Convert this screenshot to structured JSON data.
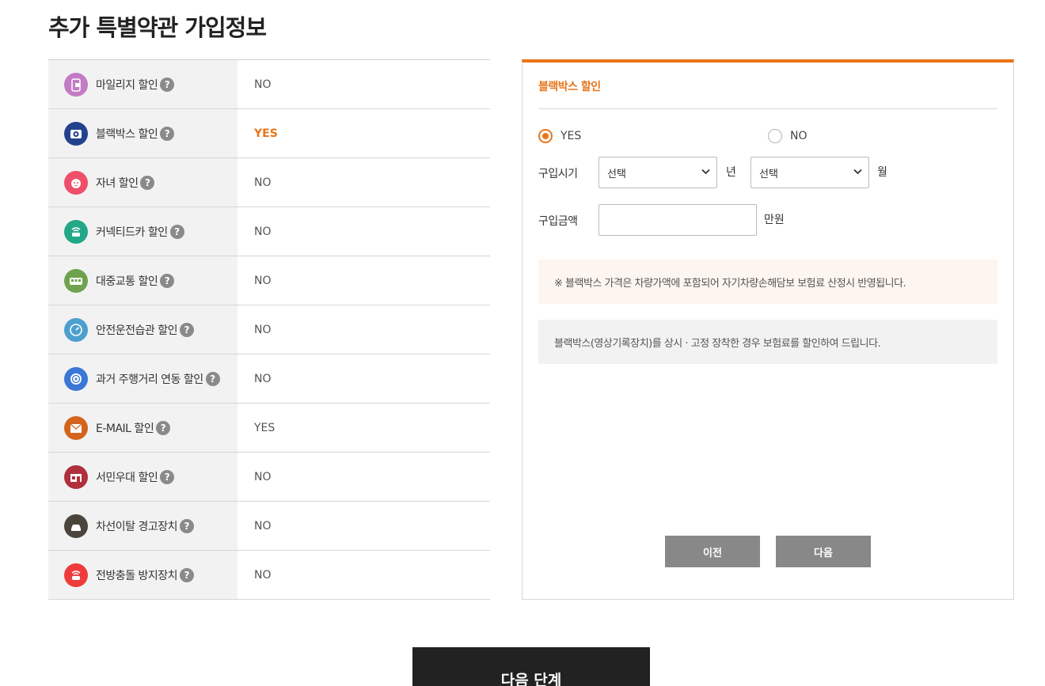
{
  "page": {
    "title": "추가 특별약관 가입정보"
  },
  "discounts": [
    {
      "label": "마일리지 할인",
      "value": "NO",
      "icon": "mileage-icon",
      "color": "#c27bc4"
    },
    {
      "label": "블랙박스 할인",
      "value": "YES",
      "icon": "blackbox-icon",
      "color": "#23418e"
    },
    {
      "label": "자녀 할인",
      "value": "NO",
      "icon": "child-icon",
      "color": "#f04f6a"
    },
    {
      "label": "커넥티드카 할인",
      "value": "NO",
      "icon": "connected-car-icon",
      "color": "#22a887"
    },
    {
      "label": "대중교통 할인",
      "value": "NO",
      "icon": "bus-icon",
      "color": "#6fa24e"
    },
    {
      "label": "안전운전습관 할인",
      "value": "NO",
      "icon": "speedometer-icon",
      "color": "#4d9fd0"
    },
    {
      "label": "과거 주행거리 연동 할인",
      "value": "NO",
      "icon": "target-icon",
      "color": "#3a77d6"
    },
    {
      "label": "E-MAIL 할인",
      "value": "YES",
      "icon": "email-icon",
      "color": "#d4641d"
    },
    {
      "label": "서민우대 할인",
      "value": "NO",
      "icon": "store-icon",
      "color": "#b0303c"
    },
    {
      "label": "차선이탈 경고장치",
      "value": "NO",
      "icon": "lane-warning-icon",
      "color": "#4a443c"
    },
    {
      "label": "전방충돌 방지장치",
      "value": "NO",
      "icon": "collision-warning-icon",
      "color": "#ef3b3b"
    }
  ],
  "help_glyph": "?",
  "panel": {
    "title": "블랙박스 할인",
    "radio_yes": "YES",
    "radio_no": "NO",
    "selected": "YES",
    "purchase_date_label": "구입시기",
    "year_select": "선택",
    "year_unit": "년",
    "month_select": "선택",
    "month_unit": "월",
    "price_label": "구입금액",
    "price_value": "",
    "price_unit": "만원",
    "notice": "※ 블랙박스 가격은 차량가액에 포함되어 자기차량손해담보 보험료 산정시 반영됩니다.",
    "info": "블랙박스(영상기록장치)를 상시 · 고정 장착한 경우 보험료를 할인하여 드립니다.",
    "prev_button": "이전",
    "next_button": "다음"
  },
  "next_step_button": "다음 단계",
  "colors": {
    "accent": "#e8751a",
    "dark_button": "#222222",
    "gray_button": "#888888"
  }
}
